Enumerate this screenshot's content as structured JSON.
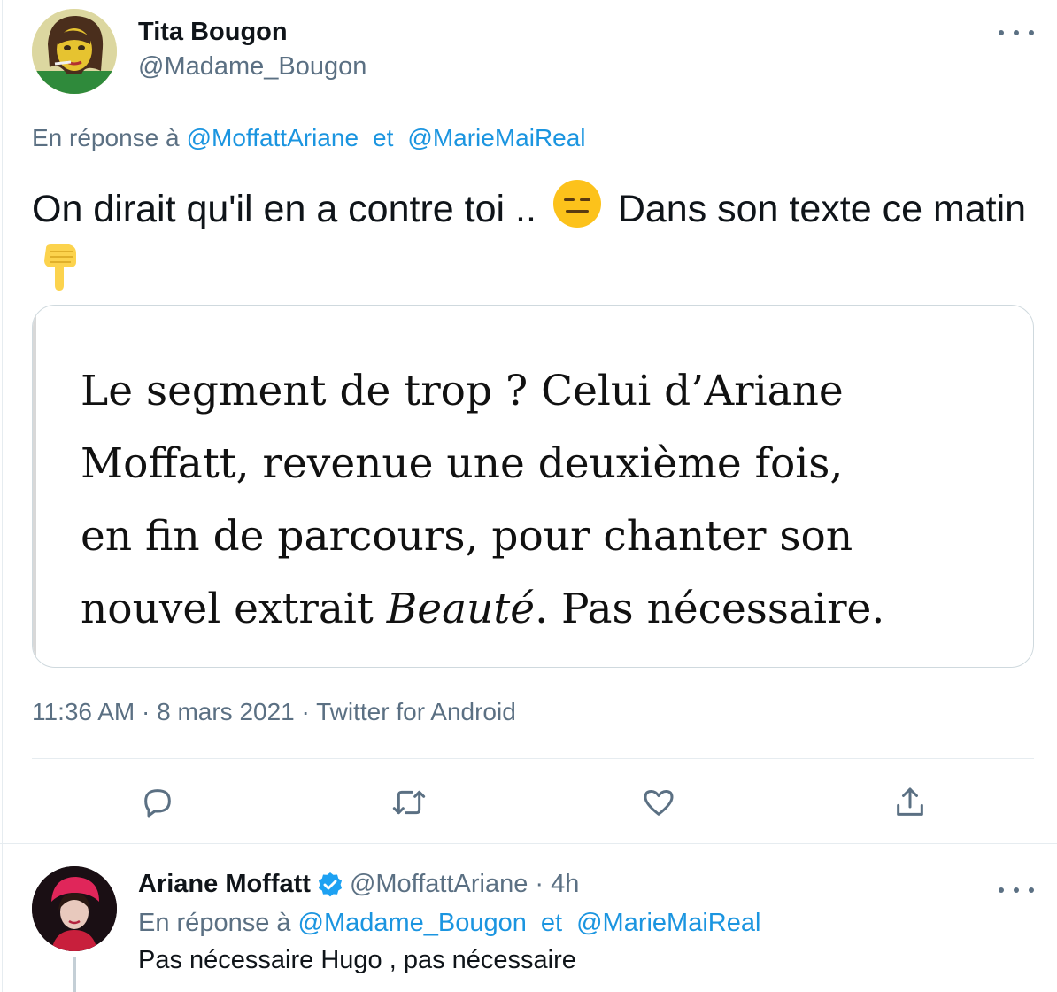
{
  "main_tweet": {
    "author_name": "Tita Bougon",
    "author_handle": "@Madame_Bougon",
    "reply_prefix": "En réponse à",
    "reply_to_1": "@MoffattAriane",
    "reply_joiner": "et",
    "reply_to_2": "@MarieMaiReal",
    "text_part_1": "On dirait qu'il en a contre toi ..",
    "text_part_2": "Dans son texte ce matin",
    "media_quote": {
      "line_1": "Le segment de trop ? Celui d’Ariane",
      "line_2": "Moffatt, revenue une deuxième fois,",
      "line_3": "en fin de parcours, pour chanter son",
      "line_4_prefix": "nouvel extrait ",
      "line_4_italic": "Beauté",
      "line_4_suffix": ". Pas nécessaire."
    },
    "meta": "11:36 AM · 8 mars 2021 · Twitter for Android",
    "emojis": [
      "expressionless-face-emoji",
      "backhand-index-pointing-down-emoji"
    ]
  },
  "reply_tweet": {
    "author_name": "Ariane Moffatt",
    "author_handle_time": "@MoffattAriane · 4h",
    "reply_prefix": "En réponse à",
    "reply_to_1": "@Madame_Bougon",
    "reply_joiner": "et",
    "reply_to_2": "@MarieMaiReal",
    "text": "Pas nécessaire Hugo , pas nécessaire"
  },
  "colors": {
    "link": "#1b95e0",
    "muted": "#5b7083",
    "text": "#0f1419",
    "border": "#e6ecf0",
    "verified": "#1da1f2"
  },
  "icons": [
    "reply-icon",
    "retweet-icon",
    "like-icon",
    "share-icon",
    "more-icon",
    "verified-badge-icon"
  ]
}
